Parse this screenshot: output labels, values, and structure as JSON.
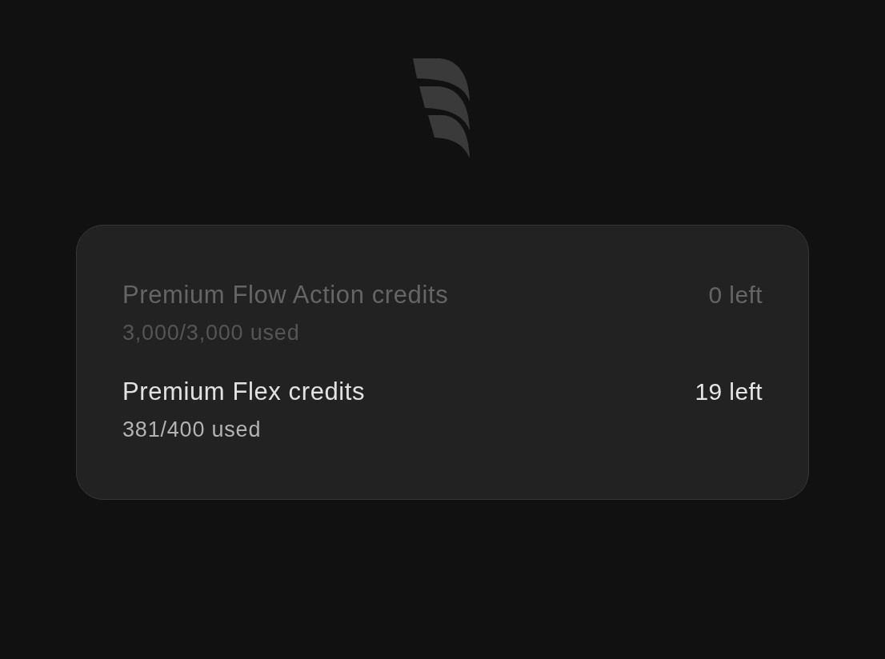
{
  "credits": [
    {
      "name": "Premium Flow Action credits",
      "usage": "3,000/3,000 used",
      "remaining": "0 left",
      "disabled": true
    },
    {
      "name": "Premium Flex credits",
      "usage": "381/400 used",
      "remaining": "19 left",
      "disabled": false
    }
  ]
}
